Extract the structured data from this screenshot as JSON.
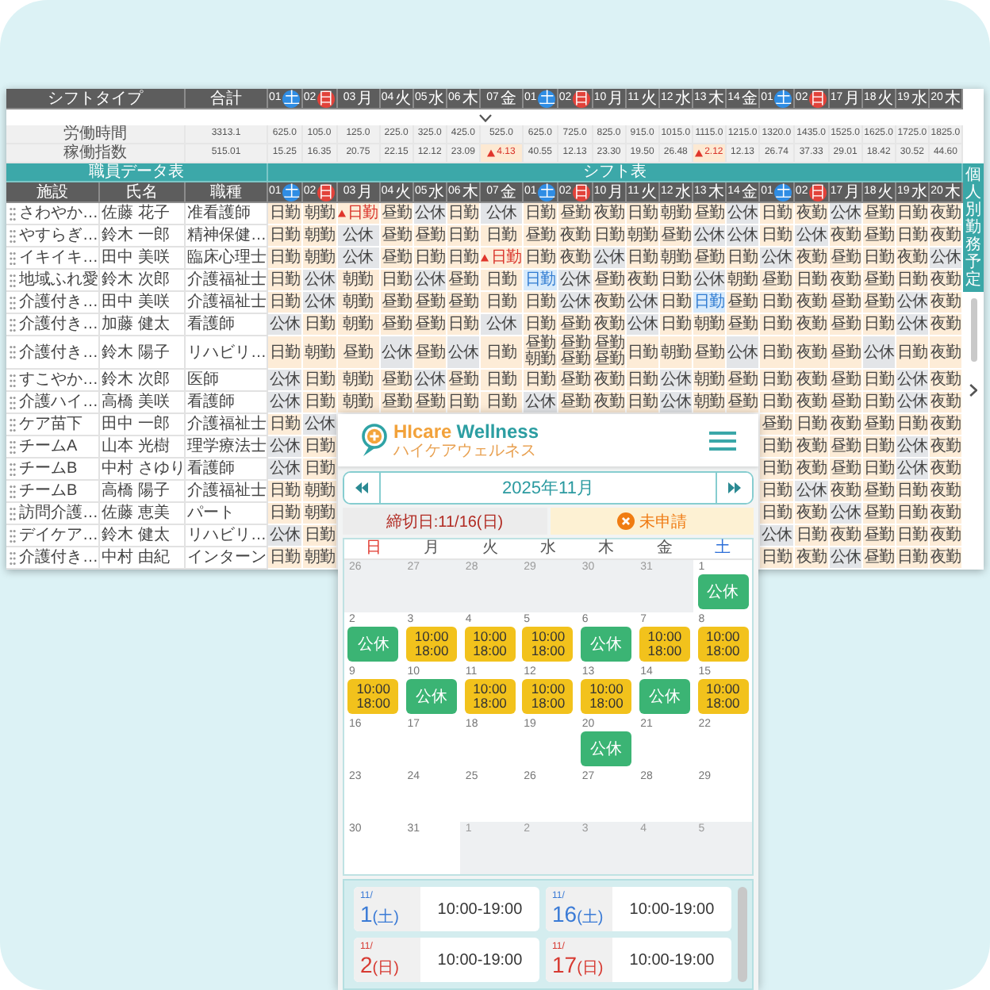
{
  "shift_table": {
    "summary_columns": {
      "shift_type": "シフトタイプ",
      "total": "合計",
      "days": [
        {
          "num": "01",
          "weekday": "土",
          "kind": "sat"
        },
        {
          "num": "02",
          "weekday": "日",
          "kind": "sun"
        },
        {
          "num": "03",
          "weekday": "月",
          "kind": "weekday"
        },
        {
          "num": "04",
          "weekday": "火",
          "kind": "weekday"
        },
        {
          "num": "05",
          "weekday": "水",
          "kind": "weekday"
        },
        {
          "num": "06",
          "weekday": "木",
          "kind": "weekday"
        },
        {
          "num": "07",
          "weekday": "金",
          "kind": "weekday"
        },
        {
          "num": "01",
          "weekday": "土",
          "kind": "sat"
        },
        {
          "num": "02",
          "weekday": "日",
          "kind": "sun"
        },
        {
          "num": "10",
          "weekday": "月",
          "kind": "weekday"
        },
        {
          "num": "11",
          "weekday": "火",
          "kind": "weekday"
        },
        {
          "num": "12",
          "weekday": "水",
          "kind": "weekday"
        },
        {
          "num": "13",
          "weekday": "木",
          "kind": "weekday"
        },
        {
          "num": "14",
          "weekday": "金",
          "kind": "weekday"
        },
        {
          "num": "01",
          "weekday": "土",
          "kind": "sat"
        },
        {
          "num": "02",
          "weekday": "日",
          "kind": "sun"
        },
        {
          "num": "17",
          "weekday": "月",
          "kind": "weekday"
        },
        {
          "num": "18",
          "weekday": "火",
          "kind": "weekday"
        },
        {
          "num": "19",
          "weekday": "水",
          "kind": "weekday"
        },
        {
          "num": "20",
          "weekday": "木",
          "kind": "weekday"
        }
      ]
    },
    "summary_rows": [
      {
        "label": "労働時間",
        "total": "3313.1",
        "values": [
          {
            "text": "625.0",
            "alert": false
          },
          {
            "text": "105.0",
            "alert": false
          },
          {
            "text": "125.0",
            "alert": false
          },
          {
            "text": "225.0",
            "alert": false
          },
          {
            "text": "325.0",
            "alert": false
          },
          {
            "text": "425.0",
            "alert": false
          },
          {
            "text": "525.0",
            "alert": false
          },
          {
            "text": "625.0",
            "alert": false
          },
          {
            "text": "725.0",
            "alert": false
          },
          {
            "text": "825.0",
            "alert": false
          },
          {
            "text": "915.0",
            "alert": false
          },
          {
            "text": "1015.0",
            "alert": false
          },
          {
            "text": "1115.0",
            "alert": false
          },
          {
            "text": "1215.0",
            "alert": false
          },
          {
            "text": "1320.0",
            "alert": false
          },
          {
            "text": "1435.0",
            "alert": false
          },
          {
            "text": "1525.0",
            "alert": false
          },
          {
            "text": "1625.0",
            "alert": false
          },
          {
            "text": "1725.0",
            "alert": false
          },
          {
            "text": "1825.0",
            "alert": false
          }
        ]
      },
      {
        "label": "稼働指数",
        "total": "515.01",
        "values": [
          {
            "text": "15.25",
            "alert": false
          },
          {
            "text": "16.35",
            "alert": false
          },
          {
            "text": "20.75",
            "alert": false
          },
          {
            "text": "22.15",
            "alert": false
          },
          {
            "text": "12.12",
            "alert": false
          },
          {
            "text": "23.09",
            "alert": false
          },
          {
            "text": "4.13",
            "alert": true
          },
          {
            "text": "40.55",
            "alert": false
          },
          {
            "text": "12.13",
            "alert": false
          },
          {
            "text": "23.30",
            "alert": false
          },
          {
            "text": "19.50",
            "alert": false
          },
          {
            "text": "26.48",
            "alert": false
          },
          {
            "text": "2.12",
            "alert": true
          },
          {
            "text": "12.13",
            "alert": false
          },
          {
            "text": "26.74",
            "alert": false
          },
          {
            "text": "37.33",
            "alert": false
          },
          {
            "text": "29.01",
            "alert": false
          },
          {
            "text": "18.42",
            "alert": false
          },
          {
            "text": "30.52",
            "alert": false
          },
          {
            "text": "44.60",
            "alert": false
          }
        ]
      }
    ],
    "sections": {
      "staff_data": "職員データ表",
      "shift_table": "シフト表"
    },
    "columns": {
      "facility": "施設",
      "name": "氏名",
      "job": "職種",
      "days": [
        {
          "num": "01",
          "weekday": "土",
          "kind": "sat"
        },
        {
          "num": "02",
          "weekday": "日",
          "kind": "sun"
        },
        {
          "num": "03",
          "weekday": "月",
          "kind": "weekday"
        },
        {
          "num": "04",
          "weekday": "火",
          "kind": "weekday"
        },
        {
          "num": "05",
          "weekday": "水",
          "kind": "weekday"
        },
        {
          "num": "06",
          "weekday": "木",
          "kind": "weekday"
        },
        {
          "num": "07",
          "weekday": "金",
          "kind": "weekday"
        },
        {
          "num": "01",
          "weekday": "土",
          "kind": "sat"
        },
        {
          "num": "02",
          "weekday": "日",
          "kind": "sun"
        },
        {
          "num": "10",
          "weekday": "月",
          "kind": "weekday"
        },
        {
          "num": "11",
          "weekday": "火",
          "kind": "weekday"
        },
        {
          "num": "12",
          "weekday": "水",
          "kind": "weekday"
        },
        {
          "num": "13",
          "weekday": "木",
          "kind": "weekday"
        },
        {
          "num": "14",
          "weekday": "金",
          "kind": "weekday"
        },
        {
          "num": "01",
          "weekday": "土",
          "kind": "sat"
        },
        {
          "num": "02",
          "weekday": "日",
          "kind": "sun"
        },
        {
          "num": "17",
          "weekday": "月",
          "kind": "weekday"
        },
        {
          "num": "18",
          "weekday": "火",
          "kind": "weekday"
        },
        {
          "num": "19",
          "weekday": "水",
          "kind": "weekday"
        },
        {
          "num": "20",
          "weekday": "木",
          "kind": "weekday"
        }
      ]
    },
    "rows": [
      {
        "facility": "さわやか…",
        "name": "佐藤 花子",
        "job": "准看護師",
        "shifts": [
          {
            "text": "日勤",
            "kind": "work"
          },
          {
            "text": "朝勤",
            "kind": "work"
          },
          {
            "text": "日勤",
            "kind": "alert"
          },
          {
            "text": "昼勤",
            "kind": "work"
          },
          {
            "text": "公休",
            "kind": "off"
          },
          {
            "text": "日勤",
            "kind": "work"
          },
          {
            "text": "公休",
            "kind": "off"
          },
          {
            "text": "日勤",
            "kind": "work"
          },
          {
            "text": "昼勤",
            "kind": "work"
          },
          {
            "text": "夜勤",
            "kind": "work"
          },
          {
            "text": "日勤",
            "kind": "work"
          },
          {
            "text": "朝勤",
            "kind": "work"
          },
          {
            "text": "昼勤",
            "kind": "work"
          },
          {
            "text": "公休",
            "kind": "off"
          },
          {
            "text": "日勤",
            "kind": "work"
          },
          {
            "text": "夜勤",
            "kind": "work"
          },
          {
            "text": "公休",
            "kind": "off"
          },
          {
            "text": "昼勤",
            "kind": "work"
          },
          {
            "text": "日勤",
            "kind": "work"
          },
          {
            "text": "夜勤",
            "kind": "work"
          }
        ]
      },
      {
        "facility": "やすらぎ…",
        "name": "鈴木 一郎",
        "job": "精神保健…",
        "shifts": [
          {
            "text": "日勤",
            "kind": "work"
          },
          {
            "text": "朝勤",
            "kind": "work"
          },
          {
            "text": "公休",
            "kind": "off"
          },
          {
            "text": "昼勤",
            "kind": "work"
          },
          {
            "text": "昼勤",
            "kind": "work"
          },
          {
            "text": "日勤",
            "kind": "work"
          },
          {
            "text": "日勤",
            "kind": "work"
          },
          {
            "text": "昼勤",
            "kind": "work"
          },
          {
            "text": "夜勤",
            "kind": "work"
          },
          {
            "text": "日勤",
            "kind": "work"
          },
          {
            "text": "朝勤",
            "kind": "work"
          },
          {
            "text": "昼勤",
            "kind": "work"
          },
          {
            "text": "公休",
            "kind": "off"
          },
          {
            "text": "公休",
            "kind": "off"
          },
          {
            "text": "日勤",
            "kind": "work"
          },
          {
            "text": "公休",
            "kind": "off"
          },
          {
            "text": "夜勤",
            "kind": "work"
          },
          {
            "text": "昼勤",
            "kind": "work"
          },
          {
            "text": "日勤",
            "kind": "work"
          },
          {
            "text": "夜勤",
            "kind": "work"
          }
        ]
      },
      {
        "facility": "イキイキ…",
        "name": "田中 美咲",
        "job": "臨床心理士",
        "shifts": [
          {
            "text": "日勤",
            "kind": "work"
          },
          {
            "text": "朝勤",
            "kind": "work"
          },
          {
            "text": "公休",
            "kind": "off"
          },
          {
            "text": "昼勤",
            "kind": "work"
          },
          {
            "text": "日勤",
            "kind": "work"
          },
          {
            "text": "日勤",
            "kind": "work"
          },
          {
            "text": "日勤",
            "kind": "alert"
          },
          {
            "text": "日勤",
            "kind": "work"
          },
          {
            "text": "夜勤",
            "kind": "work"
          },
          {
            "text": "公休",
            "kind": "off"
          },
          {
            "text": "日勤",
            "kind": "work"
          },
          {
            "text": "朝勤",
            "kind": "work"
          },
          {
            "text": "昼勤",
            "kind": "work"
          },
          {
            "text": "日勤",
            "kind": "work"
          },
          {
            "text": "公休",
            "kind": "off"
          },
          {
            "text": "夜勤",
            "kind": "work"
          },
          {
            "text": "昼勤",
            "kind": "work"
          },
          {
            "text": "日勤",
            "kind": "work"
          },
          {
            "text": "夜勤",
            "kind": "work"
          },
          {
            "text": "公休",
            "kind": "off"
          }
        ]
      },
      {
        "facility": "地域ふれ愛",
        "name": "鈴木 次郎",
        "job": "介護福祉士",
        "shifts": [
          {
            "text": "日勤",
            "kind": "work"
          },
          {
            "text": "公休",
            "kind": "off"
          },
          {
            "text": "朝勤",
            "kind": "work"
          },
          {
            "text": "日勤",
            "kind": "work"
          },
          {
            "text": "公休",
            "kind": "off"
          },
          {
            "text": "昼勤",
            "kind": "work"
          },
          {
            "text": "日勤",
            "kind": "work"
          },
          {
            "text": "日勤",
            "kind": "marked"
          },
          {
            "text": "公休",
            "kind": "off"
          },
          {
            "text": "昼勤",
            "kind": "work"
          },
          {
            "text": "夜勤",
            "kind": "work"
          },
          {
            "text": "日勤",
            "kind": "work"
          },
          {
            "text": "公休",
            "kind": "off"
          },
          {
            "text": "朝勤",
            "kind": "work"
          },
          {
            "text": "昼勤",
            "kind": "work"
          },
          {
            "text": "日勤",
            "kind": "work"
          },
          {
            "text": "夜勤",
            "kind": "work"
          },
          {
            "text": "昼勤",
            "kind": "work"
          },
          {
            "text": "日勤",
            "kind": "work"
          },
          {
            "text": "夜勤",
            "kind": "work"
          }
        ]
      },
      {
        "facility": "介護付き…",
        "name": "田中 美咲",
        "job": "介護福祉士",
        "shifts": [
          {
            "text": "日勤",
            "kind": "work"
          },
          {
            "text": "公休",
            "kind": "off"
          },
          {
            "text": "朝勤",
            "kind": "work"
          },
          {
            "text": "昼勤",
            "kind": "work"
          },
          {
            "text": "昼勤",
            "kind": "work"
          },
          {
            "text": "昼勤",
            "kind": "work"
          },
          {
            "text": "日勤",
            "kind": "work"
          },
          {
            "text": "日勤",
            "kind": "work"
          },
          {
            "text": "公休",
            "kind": "off"
          },
          {
            "text": "夜勤",
            "kind": "work"
          },
          {
            "text": "公休",
            "kind": "off"
          },
          {
            "text": "日勤",
            "kind": "work"
          },
          {
            "text": "日勤",
            "kind": "marked"
          },
          {
            "text": "昼勤",
            "kind": "work"
          },
          {
            "text": "日勤",
            "kind": "work"
          },
          {
            "text": "夜勤",
            "kind": "work"
          },
          {
            "text": "昼勤",
            "kind": "work"
          },
          {
            "text": "昼勤",
            "kind": "work"
          },
          {
            "text": "公休",
            "kind": "off"
          },
          {
            "text": "夜勤",
            "kind": "work"
          }
        ]
      },
      {
        "facility": "介護付き…",
        "name": "加藤 健太",
        "job": "看護師",
        "shifts": [
          {
            "text": "公休",
            "kind": "off"
          },
          {
            "text": "日勤",
            "kind": "work"
          },
          {
            "text": "朝勤",
            "kind": "work"
          },
          {
            "text": "昼勤",
            "kind": "work"
          },
          {
            "text": "昼勤",
            "kind": "work"
          },
          {
            "text": "日勤",
            "kind": "work"
          },
          {
            "text": "公休",
            "kind": "off"
          },
          {
            "text": "日勤",
            "kind": "work"
          },
          {
            "text": "昼勤",
            "kind": "work"
          },
          {
            "text": "夜勤",
            "kind": "work"
          },
          {
            "text": "公休",
            "kind": "off"
          },
          {
            "text": "日勤",
            "kind": "work"
          },
          {
            "text": "朝勤",
            "kind": "work"
          },
          {
            "text": "昼勤",
            "kind": "work"
          },
          {
            "text": "日勤",
            "kind": "work"
          },
          {
            "text": "夜勤",
            "kind": "work"
          },
          {
            "text": "昼勤",
            "kind": "work"
          },
          {
            "text": "日勤",
            "kind": "work"
          },
          {
            "text": "公休",
            "kind": "off"
          },
          {
            "text": "夜勤",
            "kind": "work"
          }
        ]
      },
      {
        "facility": "介護付き…",
        "name": "鈴木 陽子",
        "job": "リハビリ…",
        "shifts": [
          {
            "text": "日勤",
            "kind": "work"
          },
          {
            "text": "朝勤",
            "kind": "work"
          },
          {
            "text": "昼勤",
            "kind": "work"
          },
          {
            "text": "公休",
            "kind": "off"
          },
          {
            "text": "昼勤",
            "kind": "work"
          },
          {
            "text": "公休",
            "kind": "off"
          },
          {
            "text": "日勤",
            "kind": "work"
          },
          {
            "lines": [
              "昼勤",
              "朝勤"
            ],
            "kind": "multi"
          },
          {
            "lines": [
              "昼勤",
              "昼勤"
            ],
            "kind": "multi"
          },
          {
            "lines": [
              "昼勤",
              "昼勤"
            ],
            "kind": "multi"
          },
          {
            "text": "日勤",
            "kind": "work"
          },
          {
            "text": "朝勤",
            "kind": "work"
          },
          {
            "text": "昼勤",
            "kind": "work"
          },
          {
            "text": "公休",
            "kind": "off"
          },
          {
            "text": "日勤",
            "kind": "work"
          },
          {
            "text": "夜勤",
            "kind": "work"
          },
          {
            "text": "昼勤",
            "kind": "work"
          },
          {
            "text": "公休",
            "kind": "off"
          },
          {
            "text": "日勤",
            "kind": "work"
          },
          {
            "text": "夜勤",
            "kind": "work"
          }
        ]
      },
      {
        "facility": "すこやか…",
        "name": "鈴木 次郎",
        "job": "医師",
        "shifts": [
          {
            "text": "公休",
            "kind": "off"
          },
          {
            "text": "日勤",
            "kind": "work"
          },
          {
            "text": "朝勤",
            "kind": "work"
          },
          {
            "text": "昼勤",
            "kind": "work"
          },
          {
            "text": "公休",
            "kind": "off"
          },
          {
            "text": "昼勤",
            "kind": "work"
          },
          {
            "text": "日勤",
            "kind": "work"
          },
          {
            "text": "日勤",
            "kind": "work"
          },
          {
            "text": "昼勤",
            "kind": "work"
          },
          {
            "text": "夜勤",
            "kind": "work"
          },
          {
            "text": "日勤",
            "kind": "work"
          },
          {
            "text": "公休",
            "kind": "off"
          },
          {
            "text": "朝勤",
            "kind": "work"
          },
          {
            "text": "昼勤",
            "kind": "work"
          },
          {
            "text": "日勤",
            "kind": "work"
          },
          {
            "text": "夜勤",
            "kind": "work"
          },
          {
            "text": "昼勤",
            "kind": "work"
          },
          {
            "text": "日勤",
            "kind": "work"
          },
          {
            "text": "公休",
            "kind": "off"
          },
          {
            "text": "夜勤",
            "kind": "work"
          }
        ]
      },
      {
        "facility": "介護ハイ…",
        "name": "高橋 美咲",
        "job": "看護師",
        "shifts": [
          {
            "text": "公休",
            "kind": "off"
          },
          {
            "text": "日勤",
            "kind": "work"
          },
          {
            "text": "朝勤",
            "kind": "work"
          },
          {
            "text": "昼勤",
            "kind": "work"
          },
          {
            "text": "昼勤",
            "kind": "work"
          },
          {
            "text": "日勤",
            "kind": "work"
          },
          {
            "text": "日勤",
            "kind": "work"
          },
          {
            "text": "公休",
            "kind": "off"
          },
          {
            "text": "昼勤",
            "kind": "work"
          },
          {
            "text": "夜勤",
            "kind": "work"
          },
          {
            "text": "日勤",
            "kind": "work"
          },
          {
            "text": "公休",
            "kind": "off"
          },
          {
            "text": "朝勤",
            "kind": "work"
          },
          {
            "text": "昼勤",
            "kind": "work"
          },
          {
            "text": "日勤",
            "kind": "work"
          },
          {
            "text": "夜勤",
            "kind": "work"
          },
          {
            "text": "昼勤",
            "kind": "work"
          },
          {
            "text": "日勤",
            "kind": "work"
          },
          {
            "text": "公休",
            "kind": "off"
          },
          {
            "text": "夜勤",
            "kind": "work"
          }
        ]
      },
      {
        "facility": "ケア苗下",
        "name": "田中 一郎",
        "job": "介護福祉士",
        "shifts_left": [
          {
            "text": "日勤",
            "kind": "work"
          },
          {
            "text": "公休",
            "kind": "off"
          }
        ],
        "shifts_right": [
          {
            "text": "昼勤",
            "kind": "work"
          },
          {
            "text": "日勤",
            "kind": "work"
          },
          {
            "text": "夜勤",
            "kind": "work"
          },
          {
            "text": "昼勤",
            "kind": "work"
          },
          {
            "text": "日勤",
            "kind": "work"
          },
          {
            "text": "夜勤",
            "kind": "work"
          }
        ]
      },
      {
        "facility": "チームA",
        "name": "山本 光樹",
        "job": "理学療法士",
        "shifts_left": [
          {
            "text": "公休",
            "kind": "off"
          },
          {
            "text": "日勤",
            "kind": "work"
          }
        ],
        "shifts_right": [
          {
            "text": "日勤",
            "kind": "work"
          },
          {
            "text": "夜勤",
            "kind": "work"
          },
          {
            "text": "昼勤",
            "kind": "work"
          },
          {
            "text": "日勤",
            "kind": "work"
          },
          {
            "text": "公休",
            "kind": "off"
          },
          {
            "text": "夜勤",
            "kind": "work"
          }
        ]
      },
      {
        "facility": "チームB",
        "name": "中村 さゆり",
        "job": "看護師",
        "shifts_left": [
          {
            "text": "公休",
            "kind": "off"
          },
          {
            "text": "日勤",
            "kind": "work"
          }
        ],
        "shifts_right": [
          {
            "text": "日勤",
            "kind": "work"
          },
          {
            "text": "夜勤",
            "kind": "work"
          },
          {
            "text": "昼勤",
            "kind": "work"
          },
          {
            "text": "日勤",
            "kind": "work"
          },
          {
            "text": "公休",
            "kind": "off"
          },
          {
            "text": "夜勤",
            "kind": "work"
          }
        ]
      },
      {
        "facility": "チームB",
        "name": "高橋 陽子",
        "job": "介護福祉士",
        "shifts_left": [
          {
            "text": "日勤",
            "kind": "work"
          },
          {
            "text": "朝勤",
            "kind": "work"
          }
        ],
        "shifts_right": [
          {
            "text": "日勤",
            "kind": "work"
          },
          {
            "text": "公休",
            "kind": "off"
          },
          {
            "text": "夜勤",
            "kind": "work"
          },
          {
            "text": "昼勤",
            "kind": "work"
          },
          {
            "text": "日勤",
            "kind": "work"
          },
          {
            "text": "夜勤",
            "kind": "work"
          }
        ]
      },
      {
        "facility": "訪問介護…",
        "name": "佐藤 恵美",
        "job": "パート",
        "shifts_left": [
          {
            "text": "日勤",
            "kind": "work"
          },
          {
            "text": "朝勤",
            "kind": "work"
          }
        ],
        "shifts_right": [
          {
            "text": "日勤",
            "kind": "work"
          },
          {
            "text": "夜勤",
            "kind": "work"
          },
          {
            "text": "公休",
            "kind": "off"
          },
          {
            "text": "昼勤",
            "kind": "work"
          },
          {
            "text": "日勤",
            "kind": "work"
          },
          {
            "text": "夜勤",
            "kind": "work"
          }
        ]
      },
      {
        "facility": "デイケア…",
        "name": "鈴木 健太",
        "job": "リハビリ…",
        "shifts_left": [
          {
            "text": "公休",
            "kind": "off"
          },
          {
            "text": "日勤",
            "kind": "work"
          }
        ],
        "shifts_right": [
          {
            "text": "公休",
            "kind": "off"
          },
          {
            "text": "日勤",
            "kind": "work"
          },
          {
            "text": "夜勤",
            "kind": "work"
          },
          {
            "text": "昼勤",
            "kind": "work"
          },
          {
            "text": "日勤",
            "kind": "work"
          },
          {
            "text": "夜勤",
            "kind": "work"
          }
        ]
      },
      {
        "facility": "介護付き…",
        "name": "中村 由紀",
        "job": "インターン",
        "shifts_left": [
          {
            "text": "日勤",
            "kind": "work"
          },
          {
            "text": "朝勤",
            "kind": "work"
          }
        ],
        "shifts_right": [
          {
            "text": "日勤",
            "kind": "work"
          },
          {
            "text": "夜勤",
            "kind": "work"
          },
          {
            "text": "公休",
            "kind": "off"
          },
          {
            "text": "昼勤",
            "kind": "work"
          },
          {
            "text": "日勤",
            "kind": "work"
          },
          {
            "text": "夜勤",
            "kind": "work"
          }
        ]
      }
    ],
    "side_tab": "個人別勤務予定"
  },
  "app": {
    "logo": {
      "brand_first": "HIcare",
      "brand_second": "Wellness",
      "tagline": "ハイケアウェルネス"
    },
    "month_nav": {
      "title": "2025年11月"
    },
    "deadline": "締切日:11/16(日)",
    "status": "未申請",
    "calendar": {
      "weekdays": [
        {
          "label": "日",
          "kind": "sun"
        },
        {
          "label": "月",
          "kind": "weekday"
        },
        {
          "label": "火",
          "kind": "weekday"
        },
        {
          "label": "水",
          "kind": "weekday"
        },
        {
          "label": "木",
          "kind": "weekday"
        },
        {
          "label": "金",
          "kind": "weekday"
        },
        {
          "label": "土",
          "kind": "sat"
        }
      ],
      "weeks": [
        [
          {
            "date": "26",
            "other_month": true
          },
          {
            "date": "27",
            "other_month": true
          },
          {
            "date": "28",
            "other_month": true
          },
          {
            "date": "29",
            "other_month": true
          },
          {
            "date": "30",
            "other_month": true
          },
          {
            "date": "31",
            "other_month": true
          },
          {
            "date": "1",
            "other_month": false,
            "entry": {
              "kind": "off",
              "text": "公休"
            }
          }
        ],
        [
          {
            "date": "2",
            "other_month": false,
            "entry": {
              "kind": "off",
              "text": "公休"
            }
          },
          {
            "date": "3",
            "other_month": false,
            "entry": {
              "kind": "shift",
              "lines": [
                "10:00",
                "18:00"
              ]
            }
          },
          {
            "date": "4",
            "other_month": false,
            "entry": {
              "kind": "shift",
              "lines": [
                "10:00",
                "18:00"
              ]
            }
          },
          {
            "date": "5",
            "other_month": false,
            "entry": {
              "kind": "shift",
              "lines": [
                "10:00",
                "18:00"
              ]
            }
          },
          {
            "date": "6",
            "other_month": false,
            "entry": {
              "kind": "off",
              "text": "公休"
            }
          },
          {
            "date": "7",
            "other_month": false,
            "entry": {
              "kind": "shift",
              "lines": [
                "10:00",
                "18:00"
              ]
            }
          },
          {
            "date": "8",
            "other_month": false,
            "entry": {
              "kind": "shift",
              "lines": [
                "10:00",
                "18:00"
              ]
            }
          }
        ],
        [
          {
            "date": "9",
            "other_month": false,
            "entry": {
              "kind": "shift",
              "lines": [
                "10:00",
                "18:00"
              ]
            }
          },
          {
            "date": "10",
            "other_month": false,
            "entry": {
              "kind": "off",
              "text": "公休"
            }
          },
          {
            "date": "11",
            "other_month": false,
            "entry": {
              "kind": "shift",
              "lines": [
                "10:00",
                "18:00"
              ]
            }
          },
          {
            "date": "12",
            "other_month": false,
            "entry": {
              "kind": "shift",
              "lines": [
                "10:00",
                "18:00"
              ]
            }
          },
          {
            "date": "13",
            "other_month": false,
            "entry": {
              "kind": "shift",
              "lines": [
                "10:00",
                "18:00"
              ]
            }
          },
          {
            "date": "14",
            "other_month": false,
            "entry": {
              "kind": "off",
              "text": "公休"
            }
          },
          {
            "date": "15",
            "other_month": false,
            "entry": {
              "kind": "shift",
              "lines": [
                "10:00",
                "18:00"
              ]
            }
          }
        ],
        [
          {
            "date": "16",
            "other_month": false
          },
          {
            "date": "17",
            "other_month": false
          },
          {
            "date": "18",
            "other_month": false
          },
          {
            "date": "19",
            "other_month": false
          },
          {
            "date": "20",
            "other_month": false,
            "entry": {
              "kind": "off",
              "text": "公休"
            }
          },
          {
            "date": "21",
            "other_month": false
          },
          {
            "date": "22",
            "other_month": false
          }
        ],
        [
          {
            "date": "23",
            "other_month": false
          },
          {
            "date": "24",
            "other_month": false
          },
          {
            "date": "25",
            "other_month": false
          },
          {
            "date": "26",
            "other_month": false
          },
          {
            "date": "27",
            "other_month": false
          },
          {
            "date": "28",
            "other_month": false
          },
          {
            "date": "29",
            "other_month": false
          }
        ],
        [
          {
            "date": "30",
            "other_month": false
          },
          {
            "date": "31",
            "other_month": false
          },
          {
            "date": "1",
            "other_month": true
          },
          {
            "date": "2",
            "other_month": true
          },
          {
            "date": "3",
            "other_month": true
          },
          {
            "date": "4",
            "other_month": true
          },
          {
            "date": "5",
            "other_month": true
          }
        ]
      ]
    },
    "schedule": [
      {
        "month": "11/",
        "day": "1",
        "weekday": "(土)",
        "kind": "sat",
        "time": "10:00-19:00"
      },
      {
        "month": "11/",
        "day": "16",
        "weekday": "(土)",
        "kind": "sat",
        "time": "10:00-19:00"
      },
      {
        "month": "11/",
        "day": "2",
        "weekday": "(日)",
        "kind": "sun",
        "time": "10:00-19:00"
      },
      {
        "month": "11/",
        "day": "17",
        "weekday": "(日)",
        "kind": "sun",
        "time": "10:00-19:00"
      }
    ]
  }
}
